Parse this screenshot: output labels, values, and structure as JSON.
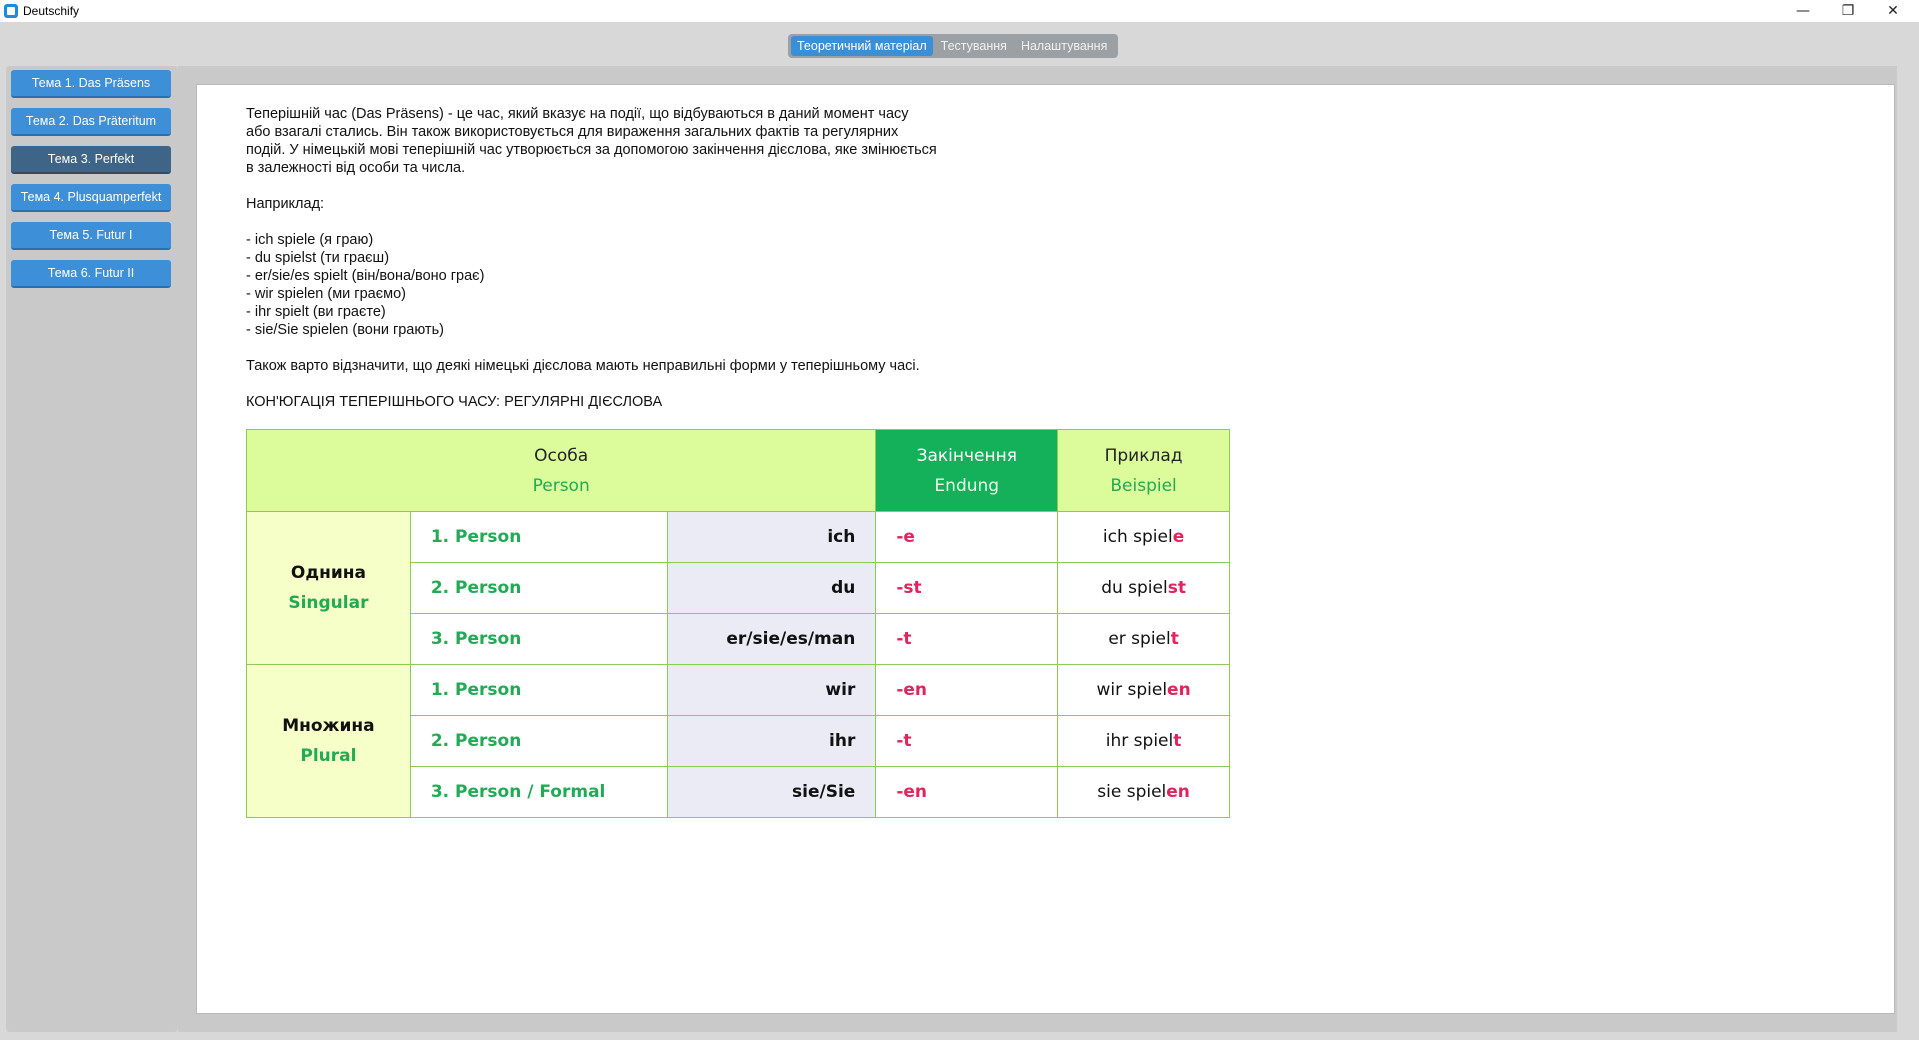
{
  "window": {
    "title": "Deutschify",
    "minimize_glyph": "—",
    "maximize_glyph": "❐",
    "close_glyph": "✕"
  },
  "tabs": [
    {
      "label": "Теоретичний матеріал",
      "active": true
    },
    {
      "label": "Тестування",
      "active": false
    },
    {
      "label": "Налаштування",
      "active": false
    }
  ],
  "sidebar": {
    "items": [
      {
        "label": "Тема 1. Das Präsens",
        "active": false
      },
      {
        "label": "Тема 2. Das Präteritum",
        "active": false
      },
      {
        "label": "Тема 3. Perfekt",
        "active": true
      },
      {
        "label": "Тема 4. Plusquamperfekt",
        "active": false
      },
      {
        "label": "Тема 5. Futur I",
        "active": false
      },
      {
        "label": "Тема 6. Futur II",
        "active": false
      }
    ]
  },
  "content": {
    "intro_lines": [
      "Теперішній час (Das Präsens) - це час, який вказує на події, що відбуваються в даний момент часу",
      "або взагалі стались. Він також використовується для вираження загальних фактів та регулярних",
      "подій. У німецькій мові теперішній час утворюється за допомогою закінчення дієслова, яке змінюється",
      "в залежності від особи та числа."
    ],
    "example_label": "Наприклад:",
    "example_lines": [
      "- ich spiele (я граю)",
      "- du spielst (ти граєш)",
      "- er/sie/es spielt (він/вона/воно грає)",
      "- wir spielen (ми граємо)",
      "- ihr spielt (ви граєте)",
      "- sie/Sie spielen (вони грають)"
    ],
    "note": "Також варто відзначити, що деякі німецькі дієслова мають неправильні форми у теперішньому часі.",
    "table_heading": "КОН'ЮГАЦІЯ ТЕПЕРІШНЬОГО ЧАСУ: РЕГУЛЯРНІ ДІЄСЛОВА"
  },
  "table": {
    "headers": {
      "person": {
        "main": "Особа",
        "sub": "Person"
      },
      "ending": {
        "main": "Закінчення",
        "sub": "Endung"
      },
      "example": {
        "main": "Приклад",
        "sub": "Beispiel"
      }
    },
    "groups": {
      "singular": {
        "main": "Однина",
        "sub": "Singular"
      },
      "plural": {
        "main": "Множина",
        "sub": "Plural"
      }
    },
    "rows": [
      {
        "person": "1. Person",
        "pronoun": "ich",
        "ending": "-e",
        "ex_stem": "ich spiel",
        "ex_end": "e"
      },
      {
        "person": "2. Person",
        "pronoun": "du",
        "ending": "-st",
        "ex_stem": "du spiel",
        "ex_end": "st"
      },
      {
        "person": "3. Person",
        "pronoun": "er/sie/es/man",
        "ending": "-t",
        "ex_stem": "er spiel",
        "ex_end": "t"
      },
      {
        "person": "1. Person",
        "pronoun": "wir",
        "ending": "-en",
        "ex_stem": "wir spiel",
        "ex_end": "en"
      },
      {
        "person": "2. Person",
        "pronoun": "ihr",
        "ending": "-t",
        "ex_stem": "ihr spiel",
        "ex_end": "t"
      },
      {
        "person": "3. Person / Formal",
        "pronoun": "sie/Sie",
        "ending": "-en",
        "ex_stem": "sie spiel",
        "ex_end": "en"
      }
    ]
  }
}
